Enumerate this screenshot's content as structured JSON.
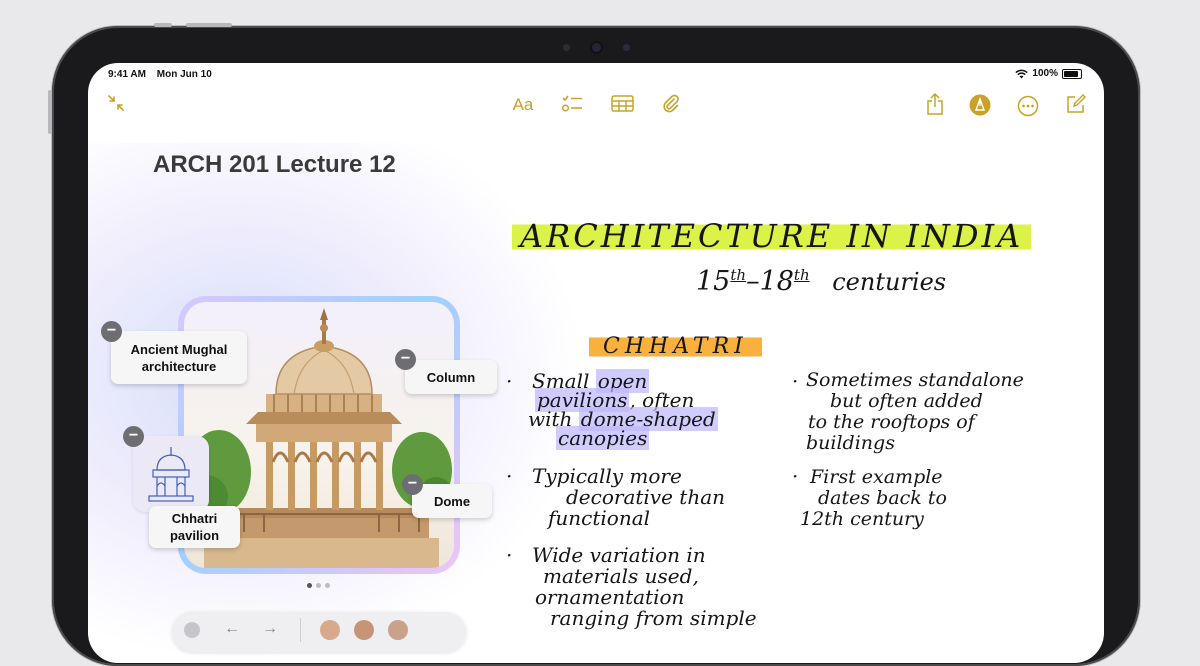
{
  "status_bar": {
    "time": "9:41 AM",
    "date": "Mon Jun 10",
    "battery": "100%"
  },
  "toolbar": {
    "format_label": "Aa"
  },
  "note": {
    "title": "ARCH 201 Lecture 12"
  },
  "handwriting": {
    "heading": "ARCHITECTURE IN INDIA",
    "period_a": "15",
    "period_a_sup": "th",
    "period_dash": "–18",
    "period_b_sup": "th",
    "period_word": "centuries",
    "subheading": "CHHATRI",
    "bullets_left": [
      {
        "pre": "Small ",
        "hl": "open",
        "post": ""
      },
      {
        "pre": "",
        "hl": "pavilions",
        "post": ", often"
      },
      {
        "pre": "with ",
        "hl": "dome-shaped",
        "post": ""
      },
      {
        "pre": "",
        "hl": "canopies",
        "post": ""
      }
    ],
    "bullet2_left": [
      "Typically more",
      "decorative than",
      "functional"
    ],
    "bullet3_left": [
      "Wide variation in",
      "materials used,",
      "ornamentation",
      "ranging from simple"
    ],
    "bullets_right": [
      "Sometimes standalone",
      "but often added",
      "to the rooftops of",
      "buildings"
    ],
    "bullet2_right": [
      "First example",
      "dates back to",
      "12th century"
    ]
  },
  "image_labels": {
    "mughal": "Ancient Mughal architecture",
    "column": "Column",
    "dome": "Dome",
    "chhatri": "Chhatri pavilion"
  },
  "colors": {
    "accent": "#c9a227",
    "highlight_yellow": "#d6f028",
    "highlight_orange": "#faa828",
    "highlight_purple": "#beb6ff"
  }
}
